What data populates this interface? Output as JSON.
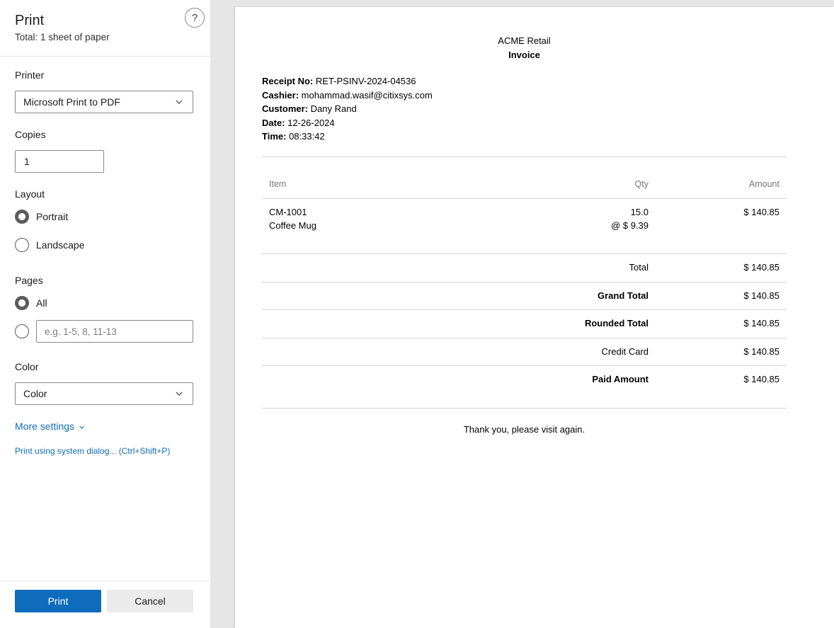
{
  "print_panel": {
    "title": "Print",
    "subtitle": "Total: 1 sheet of paper",
    "help_label": "?",
    "printer": {
      "label": "Printer",
      "selected": "Microsoft Print to PDF"
    },
    "copies": {
      "label": "Copies",
      "value": "1"
    },
    "layout": {
      "label": "Layout",
      "options": [
        "Portrait",
        "Landscape"
      ],
      "selected": "Portrait"
    },
    "pages": {
      "label": "Pages",
      "all_label": "All",
      "custom_placeholder": "e.g. 1-5, 8, 11-13",
      "selected": "All"
    },
    "color": {
      "label": "Color",
      "selected": "Color"
    },
    "more_settings": "More settings",
    "system_dialog": "Print using system dialog... (Ctrl+Shift+P)",
    "print_button": "Print",
    "cancel_button": "Cancel"
  },
  "invoice": {
    "company": "ACME Retail",
    "title": "Invoice",
    "meta": [
      {
        "label": "Receipt No:",
        "value": "RET-PSINV-2024-04536"
      },
      {
        "label": "Cashier:",
        "value": "mohammad.wasif@citixsys.com"
      },
      {
        "label": "Customer:",
        "value": "Dany Rand"
      },
      {
        "label": "Date:",
        "value": "12-26-2024"
      },
      {
        "label": "Time:",
        "value": "08:33:42"
      }
    ],
    "columns": {
      "item": "Item",
      "qty": "Qty",
      "amount": "Amount"
    },
    "items": [
      {
        "code": "CM-1001",
        "name": "Coffee Mug",
        "qty": "15.0",
        "rate": "@ $ 9.39",
        "amount": "$ 140.85"
      }
    ],
    "totals": [
      {
        "label": "Total",
        "value": "$ 140.85",
        "bold": false
      },
      {
        "label": "Grand Total",
        "value": "$ 140.85",
        "bold": true
      },
      {
        "label": "Rounded Total",
        "value": "$ 140.85",
        "bold": true
      },
      {
        "label": "Credit Card",
        "value": "$ 140.85",
        "bold": false
      },
      {
        "label": "Paid Amount",
        "value": "$ 140.85",
        "bold": true
      }
    ],
    "footer": "Thank you, please visit again."
  },
  "colors": {
    "accent": "#0f6cbd",
    "preview_background": "#e5e5e5"
  }
}
